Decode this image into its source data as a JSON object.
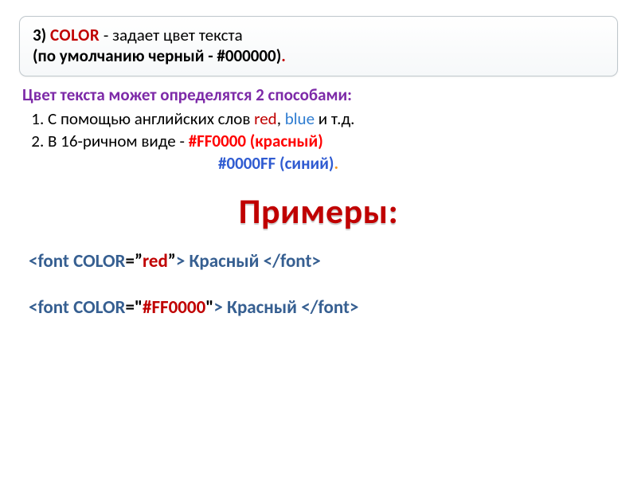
{
  "header": {
    "num": "3) ",
    "tag": "COLOR",
    "desc": " - задает цвет текста",
    "line2_pre": " (по умолчанию черный - #000000)",
    "line2_dot": "."
  },
  "intro": "Цвет текста может определятся 2 способами:",
  "methods": {
    "m1_pre": "С помощью английских слов ",
    "m1_red": "red",
    "m1_mid": ", ",
    "m1_blue": "blue",
    "m1_post": " и т.д.",
    "m2_pre": "В 16-ричном виде - ",
    "m2_hex": "#FF0000",
    "m2_paren": " (красный)",
    "m2b_hex": "#0000FF",
    "m2b_paren": " (синий)",
    "m2b_dot": "."
  },
  "examples_title": "Примеры:",
  "ex1": {
    "lt1": "<",
    "elem1": "font ",
    "attr": "COLOR",
    "eq": "=",
    "q1": "ˮ",
    "val": "red",
    "q2": "ˮ",
    "gt1": ">",
    "text": " Красный ",
    "lt2": "</",
    "elem2": "font",
    "gt2": ">"
  },
  "ex2": {
    "lt1": "<",
    "elem1": "font ",
    "attr": "COLOR",
    "eq": "=",
    "q1": "\"",
    "val": "#FF0000",
    "q2": "\"",
    "gt1": ">",
    "text": " Красный ",
    "lt2": "</",
    "elem2": "font",
    "gt2": ">"
  }
}
